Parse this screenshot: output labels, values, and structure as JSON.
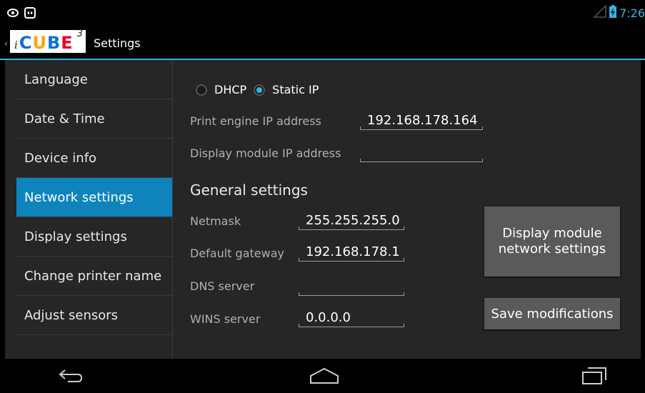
{
  "statusbar": {
    "left_icons": [
      "eye-icon",
      "screen-rotate-icon"
    ],
    "right_icons": [
      "signal-icon",
      "battery-charging-icon"
    ],
    "time": "7:26"
  },
  "actionbar": {
    "logo": {
      "i": "i",
      "letters": [
        "C",
        "U",
        "B",
        "E"
      ],
      "letter_colors": [
        "#0a6fd8",
        "#f7a800",
        "#0a6fd8",
        "#e8002a"
      ],
      "superscript": "3"
    },
    "title": "Settings"
  },
  "sidebar": {
    "items": [
      {
        "label": "Language"
      },
      {
        "label": "Date & Time"
      },
      {
        "label": "Device info"
      },
      {
        "label": "Network settings",
        "active": true
      },
      {
        "label": "Display settings"
      },
      {
        "label": "Change printer name"
      },
      {
        "label": "Adjust sensors"
      }
    ]
  },
  "network": {
    "mode": {
      "dhcp_label": "DHCP",
      "static_label": "Static IP",
      "selected": "Static IP"
    },
    "print_engine_ip": {
      "label": "Print engine IP address",
      "value": "192.168.178.164"
    },
    "display_module_ip": {
      "label": "Display module IP address",
      "value": ""
    },
    "general_title": "General settings",
    "netmask": {
      "label": "Netmask",
      "value": "255.255.255.0"
    },
    "gateway": {
      "label": "Default gateway",
      "value": "192.168.178.1"
    },
    "dns": {
      "label": "DNS server",
      "value": ""
    },
    "wins": {
      "label": "WINS server",
      "value": "0.0.0.0"
    },
    "display_module_button": "Display module network settings",
    "save_button": "Save modifications"
  },
  "navbar": {
    "icons": [
      "back-icon",
      "home-icon",
      "recent-apps-icon"
    ]
  },
  "colors": {
    "accent": "#33b5e5",
    "selected_item": "#0e84bd",
    "panel_bg": "#262626",
    "button_bg": "#5a5a5a"
  }
}
